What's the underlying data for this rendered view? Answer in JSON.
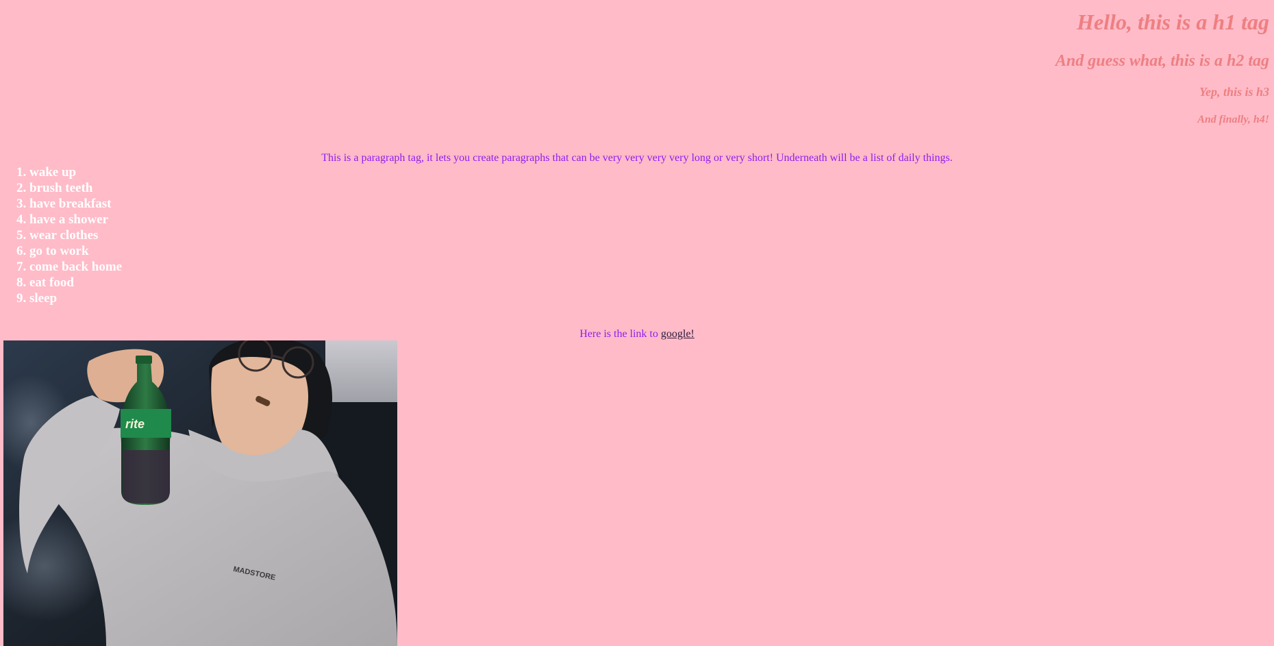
{
  "headings": {
    "h1": "Hello, this is a h1 tag",
    "h2": "And guess what, this is a h2 tag",
    "h3": "Yep, this is h3",
    "h4": "And finally, h4!"
  },
  "paragraph": "This is a paragraph tag, it lets you create paragraphs that can be very very very very long or very short! Underneath will be a list of daily things.",
  "daily_list": [
    "1. wake up",
    "2. brush teeth",
    "3. have breakfast",
    "4. have a shower",
    "5. wear clothes",
    "6. go to work",
    "7. come back home",
    "8. eat food",
    "9. sleep"
  ],
  "link_line": {
    "prefix": "Here is the link to ",
    "link_text": "google!"
  },
  "photo": {
    "hoodie_print": "MADSTORE",
    "bottle_label": "rite"
  },
  "colors": {
    "background": "#ffbbc8",
    "heading": "#ed7f82",
    "paragraph": "#8f1cf2",
    "list": "#ffffff",
    "link": "#2b1a3a"
  }
}
